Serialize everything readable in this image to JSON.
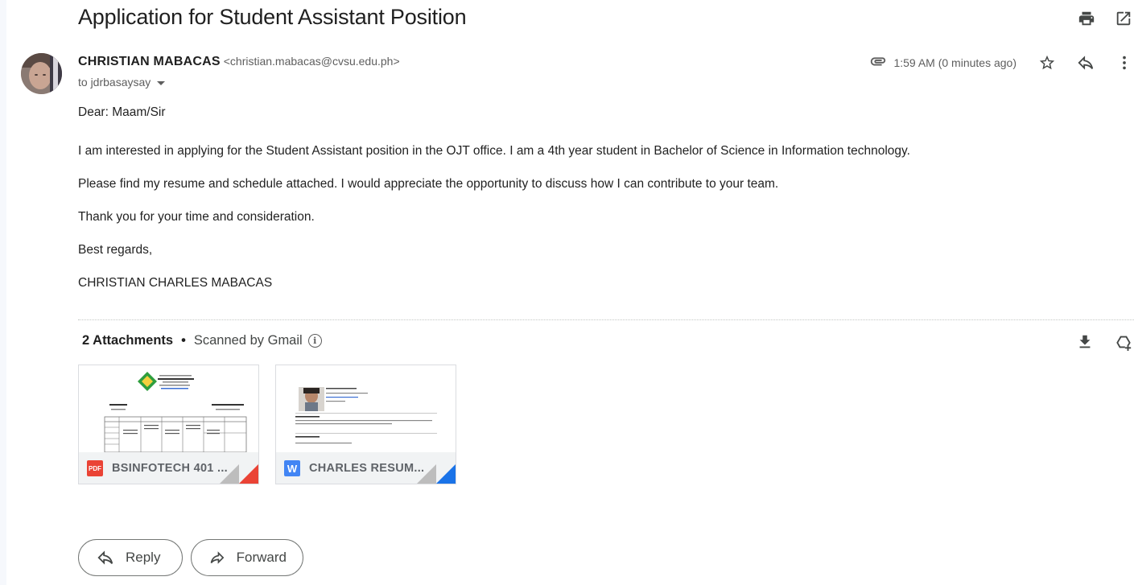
{
  "email": {
    "subject": "Application for Student Assistant Position",
    "sender_name": "CHRISTIAN MABACAS",
    "sender_email": "<christian.mabacas@cvsu.edu.ph>",
    "to_line": "to jdrbasaysay",
    "time": "1:59 AM (0 minutes ago)",
    "body": {
      "greeting": "Dear: Maam/Sir",
      "p1": "I am interested in applying for the Student Assistant position in the OJT office.  I am a 4th year student in Bachelor of Science in Information technology.",
      "p2": "Please find my resume and schedule attached. I would appreciate the opportunity to discuss how I can contribute to your team.",
      "p3": "Thank you for your time and consideration.",
      "closing": "Best regards,",
      "signature": "CHRISTIAN CHARLES MABACAS"
    }
  },
  "attachments": {
    "count_label": "2 Attachments",
    "separator": "•",
    "scanned_label": "Scanned by Gmail",
    "items": [
      {
        "type": "PDF",
        "name": "BSINFOTECH 401 ...",
        "accent": "#ea4335"
      },
      {
        "type": "W",
        "name": "CHARLES RESUM...",
        "accent": "#1a73e8"
      }
    ]
  },
  "actions": {
    "reply_label": "Reply",
    "forward_label": "Forward"
  },
  "icons": {
    "print": "print-icon",
    "open_new_window": "open-in-new-window-icon",
    "attachment": "paperclip-icon",
    "star": "star-icon",
    "reply": "reply-icon",
    "more": "more-vert-icon",
    "download_all": "download-icon",
    "add_to_drive": "add-to-drive-icon",
    "info": "info-icon"
  }
}
